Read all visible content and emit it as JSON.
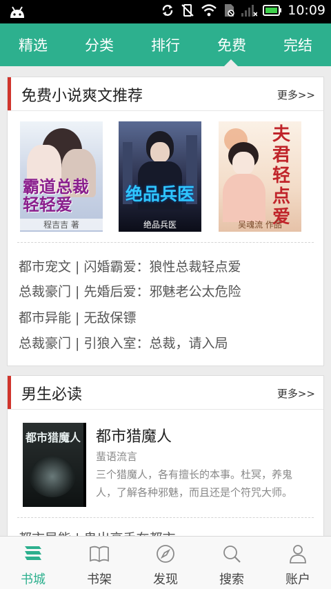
{
  "status_bar": {
    "time": "10:09"
  },
  "top_tabs": [
    {
      "label": "精选"
    },
    {
      "label": "分类"
    },
    {
      "label": "排行"
    },
    {
      "label": "免费",
      "selected": true
    },
    {
      "label": "完结"
    }
  ],
  "section_free": {
    "title": "免费小说爽文推荐",
    "more": "更多>>",
    "covers": [
      {
        "title": "霸道总裁轻轻爱",
        "author": "程吉吉 著"
      },
      {
        "title": "绝品兵医",
        "author": "绝品兵医"
      },
      {
        "title": "夫君轻点爱",
        "author": "吴魂流 作品"
      }
    ],
    "links": [
      "都市宠文 | 闪婚霸爱：狼性总裁轻点爱",
      "总裁豪门 | 先婚后爱：邪魅老公太危险",
      "都市异能 | 无敌保镖",
      "总裁豪门 | 引狼入室：总裁，请入局"
    ]
  },
  "section_boys": {
    "title": "男生必读",
    "more": "更多>>",
    "book": {
      "cover_title": "都市猎魔人",
      "name": "都市猎魔人",
      "author": "蜚语流言",
      "desc": "三个猎魔人，各有擅长的本事。杜冥，养鬼人，了解各种邪魅，而且还是个符咒大师。"
    },
    "peek": "都市异能 | 鬼出高手在都市"
  },
  "bottom_nav": [
    {
      "label": "书城",
      "icon": "bookstore-icon",
      "active": true
    },
    {
      "label": "书架",
      "icon": "bookshelf-icon"
    },
    {
      "label": "发现",
      "icon": "compass-icon"
    },
    {
      "label": "搜索",
      "icon": "search-icon"
    },
    {
      "label": "账户",
      "icon": "user-icon"
    }
  ],
  "colors": {
    "accent": "#2db08e",
    "section_bar": "#d0342c"
  }
}
